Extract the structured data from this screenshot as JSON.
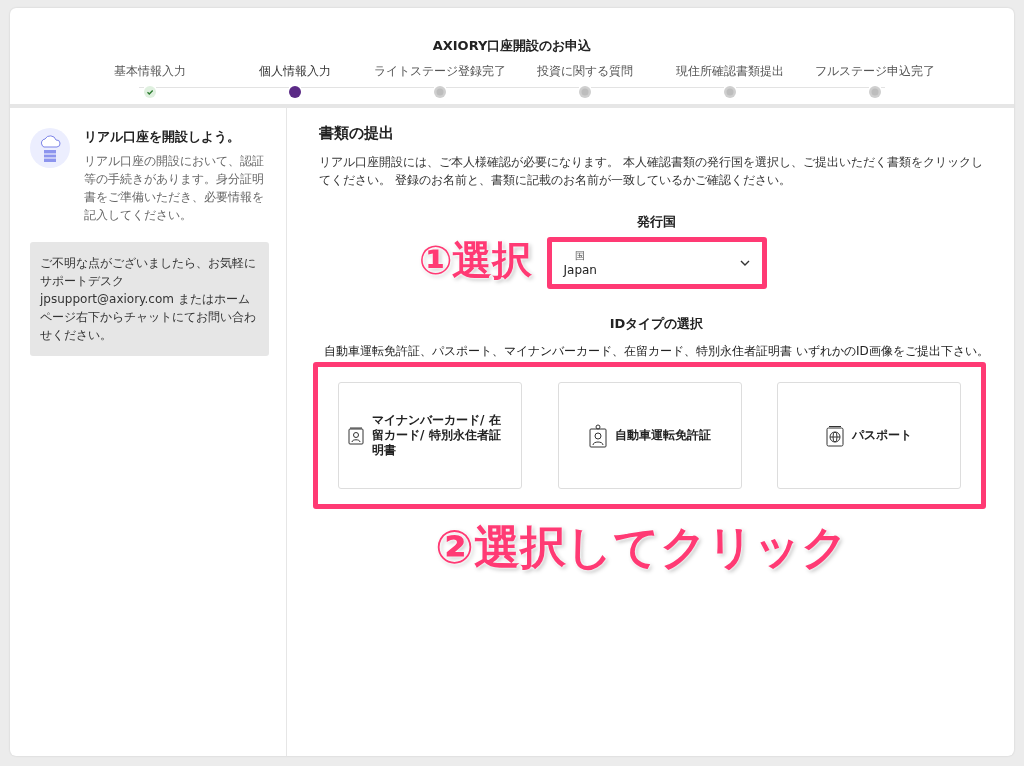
{
  "header": {
    "title": "AXIORY口座開設のお申込"
  },
  "steps": [
    {
      "label": "基本情報入力",
      "completed": true,
      "selected": false
    },
    {
      "label": "個人情報入力",
      "completed": false,
      "selected": true
    },
    {
      "label": "ライトステージ登録完了",
      "completed": false,
      "selected": false
    },
    {
      "label": "投資に関する質問",
      "completed": false,
      "selected": false
    },
    {
      "label": "現住所確認書類提出",
      "completed": false,
      "selected": false
    },
    {
      "label": "フルステージ申込完了",
      "completed": false,
      "selected": false
    }
  ],
  "sidebar": {
    "title": "リアル口座を開設しよう。",
    "text": "リアル口座の開設において、認証等の手続きがあります。身分証明書をご準備いただき、必要情報を記入してください。",
    "help": "ご不明な点がございましたら、お気軽にサポートデスク jpsupport@axiory.com またはホームページ右下からチャットにてお問い合わせください。"
  },
  "main": {
    "title": "書類の提出",
    "intro": "リアル口座開設には、ご本人様確認が必要になります。 本人確認書類の発行国を選択し、ご提出いただく書類をクリックしてください。 登録のお名前と、書類に記載のお名前が一致しているかご確認ください。",
    "country_heading": "発行国",
    "country_select": {
      "label": "国",
      "value": "Japan"
    },
    "id_heading": "IDタイプの選択",
    "id_text": "自動車運転免許証、パスポート、マイナンバーカード、在留カード、特別永住者証明書 いずれかのID画像をご提出下さい。",
    "id_options": [
      {
        "kind": "id-card",
        "label": "マイナンバーカード/ 在留カード/ 特別永住者証明書"
      },
      {
        "kind": "license",
        "label": "自動車運転免許証"
      },
      {
        "kind": "passport",
        "label": "パスポート"
      }
    ]
  },
  "annotations": {
    "step1": "①選択",
    "step2": "②選択してクリック"
  }
}
